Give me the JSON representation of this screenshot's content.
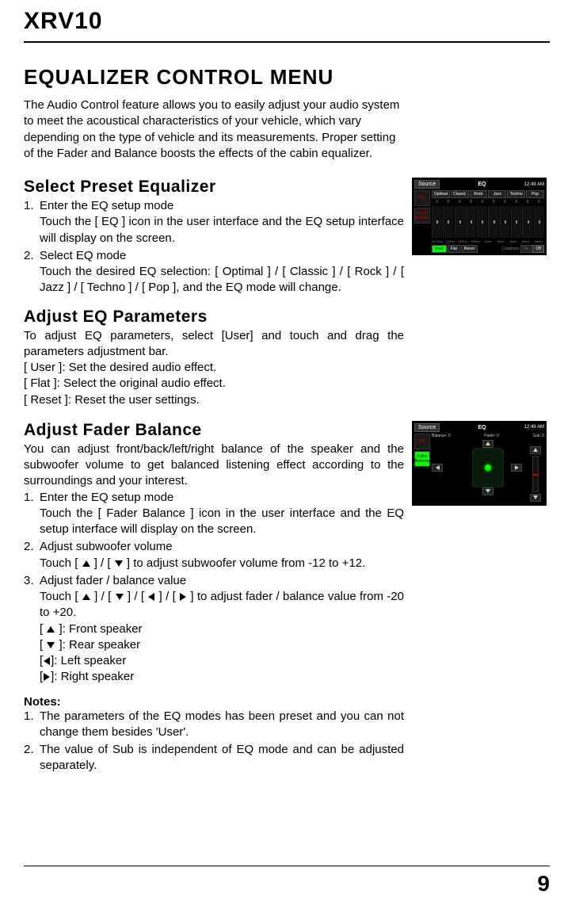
{
  "product": "XRV10",
  "page_number": "9",
  "section_title": "EQUALIZER CONTROL MENU",
  "intro": "The Audio Control feature allows you to easily adjust your audio system to meet the acoustical characteristics of your vehicle, which vary depending on the type of vehicle and its measurements. Proper setting of the Fader and Balance boosts the effects of the cabin equalizer.",
  "preset": {
    "heading": "Select Preset Equalizer",
    "step1_title": "Enter the EQ setup mode",
    "step1_body": "Touch the [ EQ ] icon in the user interface and the EQ setup interface will display on the screen.",
    "step2_title": "Select EQ mode",
    "step2_body": "Touch the desired EQ selection: [ Optimal ] / [ Classic ] / [ Rock ] / [ Jazz ] / [ Techno ] / [ Pop ], and the EQ mode will change."
  },
  "params": {
    "heading": "Adjust EQ Parameters",
    "body": "To adjust EQ parameters, select [User] and touch and drag the parameters adjustment bar.",
    "user": "[ User ]: Set the desired audio effect.",
    "flat": "[ Flat ]:  Select the original audio effect.",
    "reset": "[ Reset ]: Reset the user settings."
  },
  "fader": {
    "heading": "Adjust Fader Balance",
    "intro": "You can adjust front/back/left/right balance of the speaker and the subwoofer volume to get balanced listening effect according to the surroundings and your interest.",
    "step1_title": "Enter the EQ setup mode",
    "step1_body": "Touch the [ Fader Balance ] icon in the user interface and the EQ setup interface will display on the screen.",
    "step2_title": "Adjust subwoofer volume",
    "step2_body_pre": "Touch [ ",
    "step2_body_mid": " ] / [ ",
    "step2_body_post": " ] to adjust subwoofer volume from -12 to +12.",
    "step3_title": "Adjust fader / balance value",
    "step3_pre": "Touch [ ",
    "step3_sep": " ] / [ ",
    "step3_post": " ]  to adjust  fader / balance value from -20 to +20.",
    "front_label": " ]: Front speaker",
    "rear_label": " ]: Rear speaker",
    "left_label": "]: Left speaker",
    "right_label": "]: Right speaker",
    "bracket_open": "[ ",
    "bracket_open_tight": "["
  },
  "notes": {
    "heading": "Notes:",
    "n1": "The parameters of the EQ modes has been preset and you can not change them besides 'User'.",
    "n2": "The value of Sub is independent of EQ mode and can be adjusted separately."
  },
  "shot1": {
    "source": "Source",
    "title": "EQ",
    "time": "12:49 AM",
    "side_eq": "EQ",
    "side_fb": "Fader Balance",
    "presets": [
      "Optimal",
      "Classic",
      "Rock",
      "Jazz",
      "Techno",
      "Pop"
    ],
    "zeros": [
      "0",
      "0",
      "0",
      "0",
      "0",
      "0",
      "0",
      "0",
      "0",
      "0"
    ],
    "freqs": [
      "62.5Hz",
      "125Hz",
      "250Hz",
      "500Hz",
      "1kHz",
      "2kHz",
      "4kHz",
      "8kHz",
      "16kHz"
    ],
    "user": "User",
    "flat": "Flat",
    "reset": "Reset",
    "loudness": "Loudness",
    "on": "On",
    "off": "Off"
  },
  "shot2": {
    "source": "Source",
    "title": "EQ",
    "time": "12:49 AM",
    "balance": "Balance: 0",
    "fader_v": "Fader: 0",
    "sub": "Sub: 0",
    "side_eq": "EQ",
    "side_fb": "Fader Balance"
  }
}
